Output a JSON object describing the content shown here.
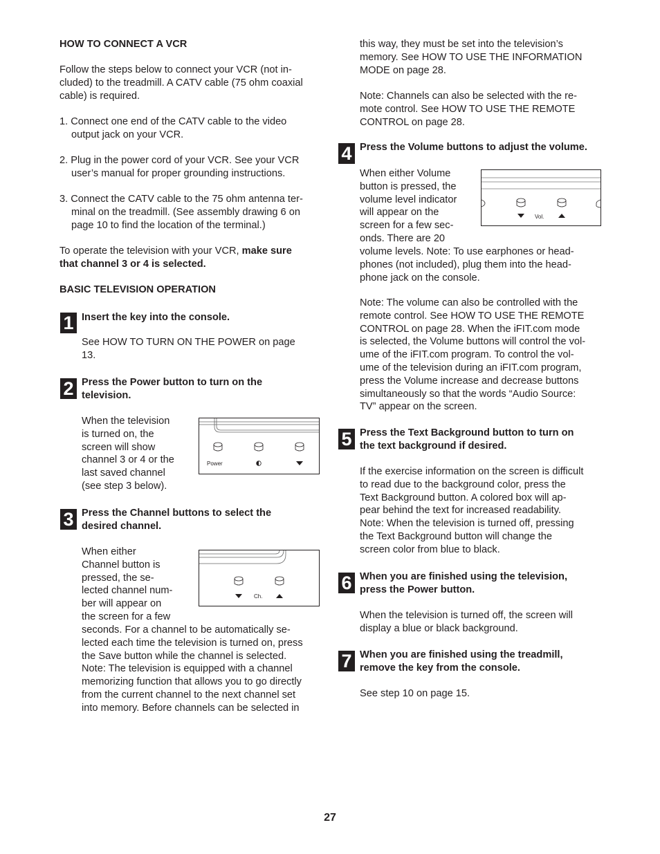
{
  "left": {
    "vcr_heading": "HOW TO CONNECT A VCR",
    "vcr_intro": [
      "Follow the steps below to connect your VCR (not in-",
      "cluded) to the treadmill. A CATV cable (75 ohm coaxial",
      "cable) is required."
    ],
    "vcr_steps": [
      [
        "1. Connect one end of the CATV cable to the video",
        "output jack on your VCR."
      ],
      [
        "2. Plug in the power cord of your VCR. See your VCR",
        "user’s manual for proper grounding instructions."
      ],
      [
        "3. Connect the CATV cable to the 75 ohm antenna ter-",
        "minal on the treadmill. (See assembly drawing 6 on",
        "page 10 to find the location of the terminal.)"
      ]
    ],
    "vcr_note_plain": "To operate the television with your VCR, ",
    "vcr_note_bold_1": "make sure",
    "vcr_note_bold_2": "that channel 3 or 4 is selected.",
    "basic_heading": "BASIC TELEVISION OPERATION"
  },
  "steps": [
    {
      "num": "1",
      "title": [
        "Insert the key into the console."
      ],
      "body": [
        "See HOW TO TURN ON THE POWER on page",
        "13."
      ]
    },
    {
      "num": "2",
      "title": [
        "Press the Power button to turn on the",
        "television."
      ],
      "body": [
        "When the television",
        "is turned on, the",
        "screen will show",
        "channel 3 or 4 or the",
        "last saved channel",
        "(see step 3 below)."
      ]
    },
    {
      "num": "3",
      "title": [
        "Press the Channel buttons to select the",
        "desired channel."
      ],
      "body": [
        "When either",
        "Channel button is",
        "pressed, the se-",
        "lected channel num-",
        "ber will appear on",
        "the screen for a few"
      ],
      "body_cont": [
        "seconds. For a channel to be automatically se-",
        "lected each time the television is turned on, press",
        "the Save button while the channel is selected.",
        "Note: The television is equipped with a channel",
        "memorizing function that allows you to go directly",
        "from the current channel to the next channel set",
        "into memory. Before channels can be selected in"
      ]
    },
    {
      "num": "4",
      "title": [
        "Press the Volume buttons to adjust the volume."
      ],
      "body": [
        "When either Volume",
        "button is pressed, the",
        "volume level indicator",
        "will appear on the",
        "screen for a few sec-",
        "onds. There are 20"
      ],
      "body_cont": [
        "volume levels. Note: To use earphones or head-",
        "phones (not included), plug them into the head-",
        "phone jack on the console."
      ],
      "note": [
        "Note: The volume can also be controlled with the",
        "remote control. See HOW TO USE THE REMOTE",
        "CONTROL on page 28. When the iFIT.com mode",
        "is selected, the Volume buttons will control the vol-",
        "ume of the iFIT.com program. To control the vol-",
        "ume of the television during an iFIT.com program,",
        "press the Volume increase and decrease buttons",
        "simultaneously so that the words “Audio Source:",
        "TV” appear on the screen."
      ]
    },
    {
      "num": "5",
      "title": [
        "Press the Text Background button to turn on",
        "the text background if desired."
      ],
      "body": [
        "If the exercise information on the screen is difficult",
        "to read due to the background color, press the",
        "Text Background button. A colored box will ap-",
        "pear behind the text for increased readability.",
        "Note: When the television is turned off, pressing",
        "the Text Background button will change the",
        "screen color from blue to black."
      ]
    },
    {
      "num": "6",
      "title": [
        "When you are finished using the television,",
        "press the Power button."
      ],
      "body": [
        "When the television is turned off, the screen will",
        "display a blue or black background."
      ]
    },
    {
      "num": "7",
      "title": [
        "When you are finished using the treadmill,",
        "remove the key from the console."
      ],
      "body": [
        "See step 10 on page 15."
      ]
    }
  ],
  "right_top": {
    "cont": [
      "this way, they must be set into the television’s",
      "memory. See HOW TO USE THE INFORMATION",
      "MODE on page 28."
    ],
    "note": [
      "Note: Channels can also be selected with the re-",
      "mote control. See HOW TO USE THE REMOTE",
      "CONTROL on page 28."
    ]
  },
  "diagrams": {
    "power": {
      "labels": [
        "Power"
      ],
      "icons": [
        "power-button-icon",
        "contrast-icon",
        "down-triangle-icon"
      ]
    },
    "channel": {
      "label": "Ch.",
      "icons": [
        "down-triangle-icon",
        "up-triangle-icon"
      ]
    },
    "volume": {
      "label": "Vol.",
      "icons": [
        "down-triangle-icon",
        "up-triangle-icon"
      ]
    }
  },
  "page_number": "27"
}
